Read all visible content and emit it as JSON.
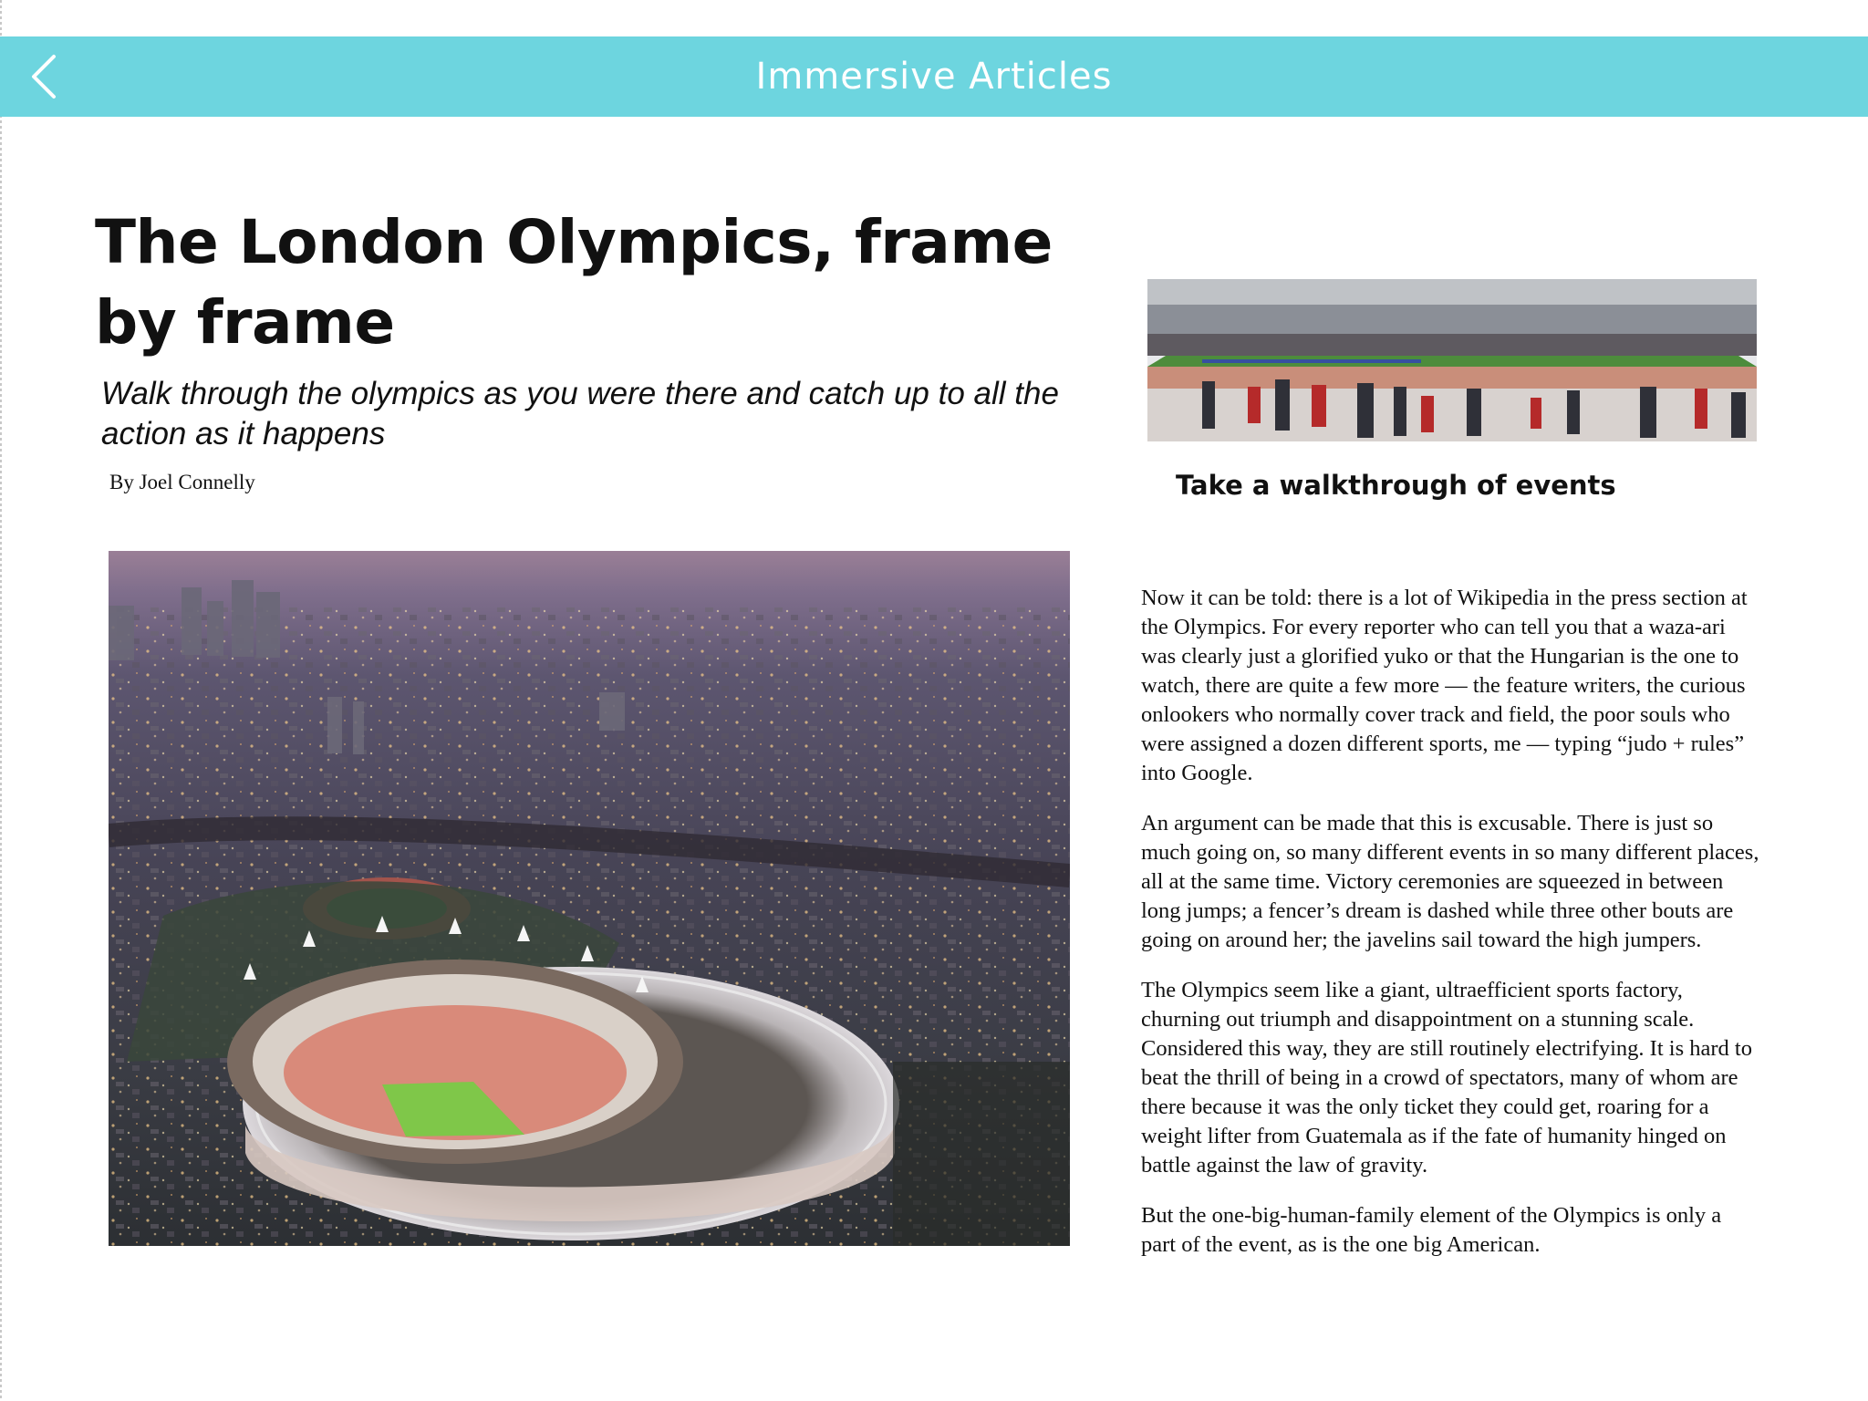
{
  "nav": {
    "title": "Immersive Articles",
    "back_icon": "chevron-left-icon",
    "background": "#6dd5df"
  },
  "article": {
    "title": "The London Olympics, frame by frame",
    "subtitle": "Walk through the olympics as you were there and catch up to all the action as it happens",
    "byline": "By Joel Connelly",
    "walkthrough_caption": "Take a walkthrough of events",
    "paragraphs": [
      "Now it can be told: there is a lot of Wikipedia in the press section at the Olympics. For every reporter who can tell you that a waza-ari was clearly just a glorified yuko or that the Hungarian is the one to watch, there are quite a few more — the feature writers, the curious onlookers who normally cover track and field, the poor souls who were assigned a dozen different sports, me — typing “judo + rules” into Google.",
      "An argument can be made that this is excusable. There is just so much going on, so many different events in so many different places, all at the same time. Victory ceremonies are squeezed in between long jumps; a fencer’s dream is dashed while three other bouts are going on around her; the javelins sail toward the high jumpers.",
      "The Olympics seem like a giant, ultraefficient sports factory, churning out triumph and disappointment on a stunning scale. Considered this way, they are still routinely electrifying. It is hard to beat the thrill of being in a crowd of spectators, many of whom are there because it was the only ticket they could get, roaring for a weight lifter from Guatemala as if the fate of humanity hinged on battle against the law of gravity.",
      "But the one-big-human-family element of the Olympics is only a part of the event, as is the one big American."
    ]
  }
}
